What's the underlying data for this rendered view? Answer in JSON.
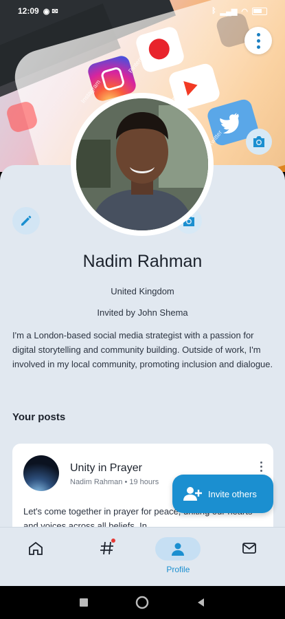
{
  "status_bar": {
    "time": "12:09",
    "battery": ""
  },
  "cover": {
    "app_labels": [
      "Instagram",
      "Pinterest",
      "YouTube",
      "Twitter"
    ]
  },
  "profile": {
    "name": "Nadim Rahman",
    "country": "United Kingdom",
    "invited_by": "Invited by John Shema",
    "bio": "I'm a London-based social media strategist with a passion for digital storytelling and community building. Outside of work, I'm involved in my local community, promoting inclusion and dialogue."
  },
  "posts": {
    "heading": "Your posts",
    "items": [
      {
        "title": "Unity in Prayer",
        "meta": "Nadim Rahman • 19 hours",
        "body": "Let's come together in prayer for peace, uniting our hearts and voices across all beliefs. In"
      }
    ]
  },
  "fab": {
    "label": "Invite others"
  },
  "bottom_nav": {
    "items": [
      {
        "label": "",
        "icon": "home-icon"
      },
      {
        "label": "",
        "icon": "hashtag-icon"
      },
      {
        "label": "Profile",
        "icon": "person-icon",
        "active": true
      },
      {
        "label": "",
        "icon": "mail-icon"
      }
    ]
  },
  "colors": {
    "accent": "#1b8fd0",
    "background": "#e1e8f0",
    "notification": "#e53935"
  }
}
